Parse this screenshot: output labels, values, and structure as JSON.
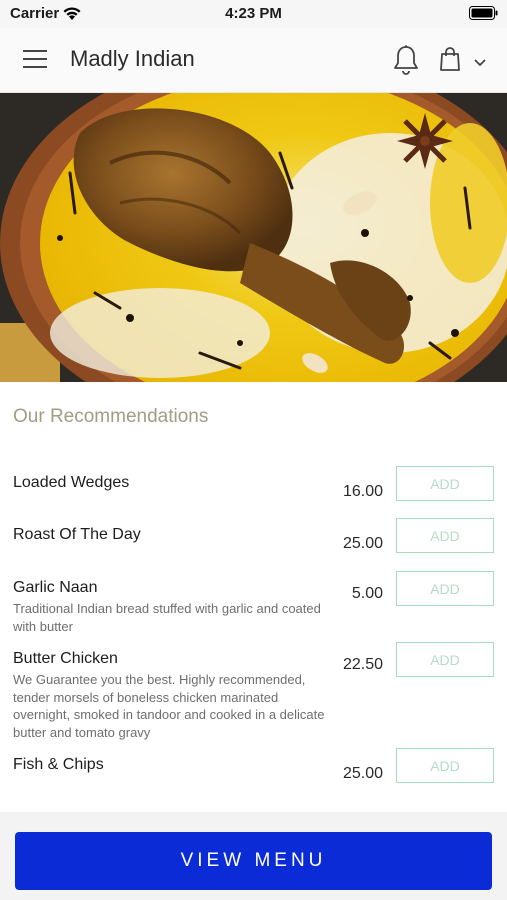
{
  "status_bar": {
    "carrier": "Carrier",
    "time": "4:23 PM"
  },
  "header": {
    "title": "Madly Indian",
    "icons": [
      "menu-icon",
      "bell-icon",
      "shopping-bag-icon",
      "chevron-down-icon"
    ]
  },
  "hero": {
    "image": "chicken-biryani-photo"
  },
  "recommendations": {
    "title": "Our Recommendations",
    "items": [
      {
        "name": "Loaded Wedges",
        "description": "",
        "price": "16.00",
        "add_label": "ADD"
      },
      {
        "name": "Roast Of The Day",
        "description": "",
        "price": "25.00",
        "add_label": "ADD"
      },
      {
        "name": "Garlic Naan",
        "description": "Traditional Indian bread stuffed with garlic and coated with butter",
        "price": "5.00",
        "add_label": "ADD"
      },
      {
        "name": "Butter Chicken",
        "description": "We Guarantee you the best. Highly recommended, tender morsels of boneless chicken marinated overnight, smoked in tandoor and cooked in a delicate butter and tomato gravy",
        "price": "22.50",
        "add_label": "ADD"
      },
      {
        "name": "Fish & Chips",
        "description": "",
        "price": "25.00",
        "add_label": "ADD"
      }
    ]
  },
  "footer": {
    "view_menu_label": "VIEW MENU"
  },
  "colors": {
    "primary_button": "#0a2bd6",
    "section_title": "#a39c84",
    "add_border": "#a8dcc0"
  }
}
